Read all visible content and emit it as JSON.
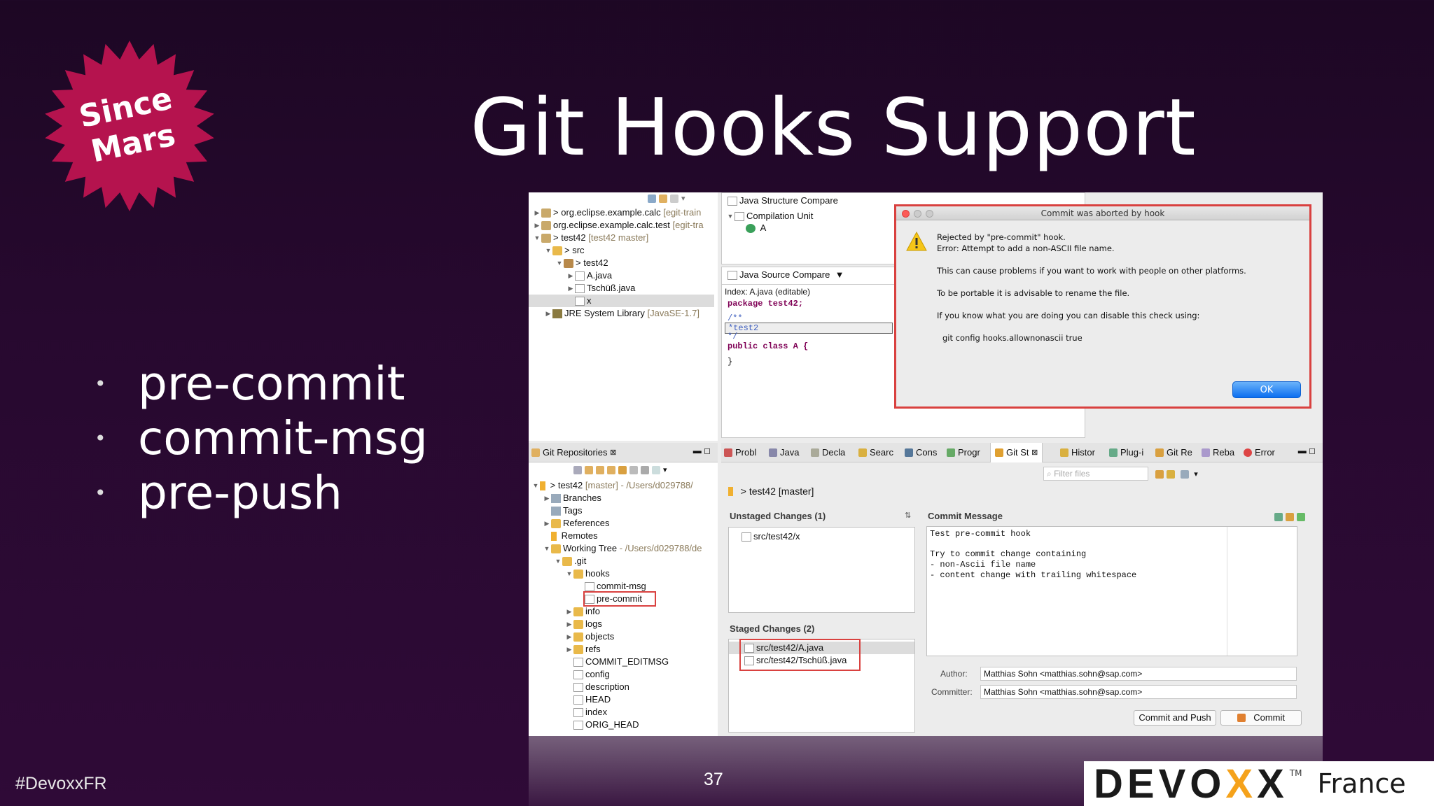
{
  "slide": {
    "title": "Git Hooks Support",
    "badge_line1": "Since",
    "badge_line2": "Mars",
    "bullets": [
      "pre-commit",
      "commit-msg",
      "pre-push"
    ],
    "bullet_symbol": "•",
    "hashtag": "#DevoxxFR",
    "page_number": "37",
    "logo_main": "DEVO",
    "logo_x": "X",
    "logo_x2": "X",
    "logo_tm": "TM",
    "logo_suffix": "France",
    "colors": {
      "badge": "#b5134e",
      "background": "#27092f",
      "logo_accent": "#f5a21b"
    }
  },
  "package_explorer": {
    "items": [
      {
        "label": "org.eclipse.example.calc",
        "meta": "[egit-train"
      },
      {
        "label": "org.eclipse.example.calc.test",
        "meta": "[egit-tra"
      },
      {
        "label": "test42",
        "meta": "[test42 master]"
      },
      {
        "label": "src",
        "meta": ""
      },
      {
        "label": "test42",
        "meta": ""
      },
      {
        "label": "A.java",
        "meta": ""
      },
      {
        "label": "Tschüß.java",
        "meta": ""
      },
      {
        "label": "x",
        "meta": ""
      },
      {
        "label": "JRE System Library",
        "meta": "[JavaSE-1.7]"
      }
    ]
  },
  "structure_compare": {
    "title": "Java Structure Compare",
    "compilation_unit": "Compilation Unit",
    "class_a": "A"
  },
  "source_compare": {
    "title": "Java Source Compare",
    "index_label": "Index: A.java (editable)",
    "code": [
      "package test42;",
      "/**",
      " *test2",
      " */",
      "public class A {",
      "}"
    ]
  },
  "dialog": {
    "title": "Commit was aborted by hook",
    "lines": [
      "Rejected by \"pre-commit\" hook.",
      "Error: Attempt to add a non-ASCII file name.",
      "This can cause problems if you want to work with people on other platforms.",
      "To be portable it is advisable to rename the file.",
      "If you know what you are doing you can disable this check using:",
      "git config hooks.allownonascii true"
    ],
    "ok_label": "OK"
  },
  "git_repositories": {
    "title": "Git Repositories",
    "repo": "test42",
    "repo_meta": "[master] - /Users/d029788/",
    "items": [
      "Branches",
      "Tags",
      "References",
      "Remotes"
    ],
    "working_tree": "Working Tree",
    "working_tree_meta": "- /Users/d029788/de",
    "git_folder": ".git",
    "hooks_folder": "hooks",
    "hooks": [
      "commit-msg",
      "pre-commit"
    ],
    "git_items": [
      "info",
      "logs",
      "objects",
      "refs",
      "COMMIT_EDITMSG",
      "config",
      "description",
      "HEAD",
      "index",
      "ORIG_HEAD"
    ]
  },
  "bottom_tabs": [
    "Probl",
    "Java",
    "Decla",
    "Searc",
    "Cons",
    "Progr",
    "Git St",
    "Histor",
    "Plug-i",
    "Git Re",
    "Reba",
    "Error"
  ],
  "git_staging": {
    "filter_placeholder": "Filter files",
    "repo_label": "> test42 [master]",
    "unstaged_header": "Unstaged Changes (1)",
    "unstaged_files": [
      "src/test42/x"
    ],
    "staged_header": "Staged Changes (2)",
    "staged_files": [
      "src/test42/A.java",
      "src/test42/Tschüß.java"
    ],
    "commit_message_header": "Commit Message",
    "commit_message_lines": [
      "Test pre-commit hook",
      "",
      "Try to commit change containing",
      "- non-Ascii file name",
      "- content change with trailing whitespace"
    ],
    "author_label": "Author:",
    "author_value": "Matthias Sohn <matthias.sohn@sap.com>",
    "committer_label": "Committer:",
    "committer_value": "Matthias Sohn <matthias.sohn@sap.com>",
    "commit_and_push_label": "Commit and Push",
    "commit_label": "Commit"
  }
}
